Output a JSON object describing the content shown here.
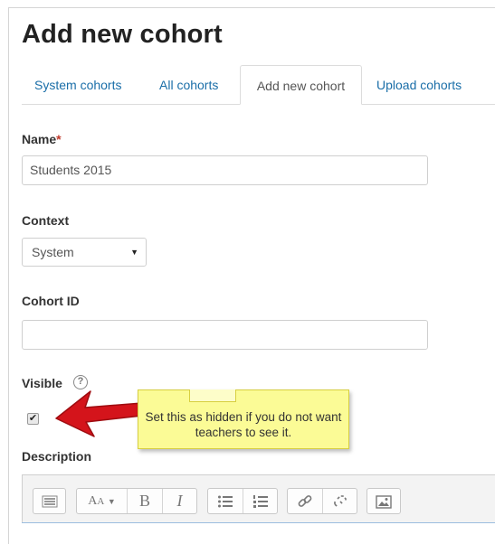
{
  "page": {
    "title": "Add new cohort"
  },
  "tabs": [
    {
      "label": "System cohorts",
      "active": false
    },
    {
      "label": "All cohorts",
      "active": false
    },
    {
      "label": "Add new cohort",
      "active": true
    },
    {
      "label": "Upload cohorts",
      "active": false
    }
  ],
  "form": {
    "name": {
      "label": "Name",
      "required_mark": "*",
      "value": "Students 2015"
    },
    "context": {
      "label": "Context",
      "selected": "System"
    },
    "cohort_id": {
      "label": "Cohort ID",
      "value": ""
    },
    "visible": {
      "label": "Visible",
      "checked": true,
      "help_glyph": "?"
    },
    "description": {
      "label": "Description"
    }
  },
  "callout": {
    "text": "Set this as hidden if you do not want teachers to see it."
  },
  "editor_toolbar": {
    "icons": [
      "toolbar-toggle-icon",
      "font-size-icon",
      "bold-icon",
      "italic-icon",
      "unordered-list-icon",
      "ordered-list-icon",
      "link-icon",
      "unlink-icon",
      "image-icon"
    ],
    "bold_glyph": "B",
    "italic_glyph": "I",
    "font_glyph": "A",
    "font_glyph_small": "A"
  },
  "colors": {
    "link": "#1a6ea8",
    "required": "#c0392b",
    "callout_bg": "#fbfb96",
    "arrow": "#d4141b"
  }
}
